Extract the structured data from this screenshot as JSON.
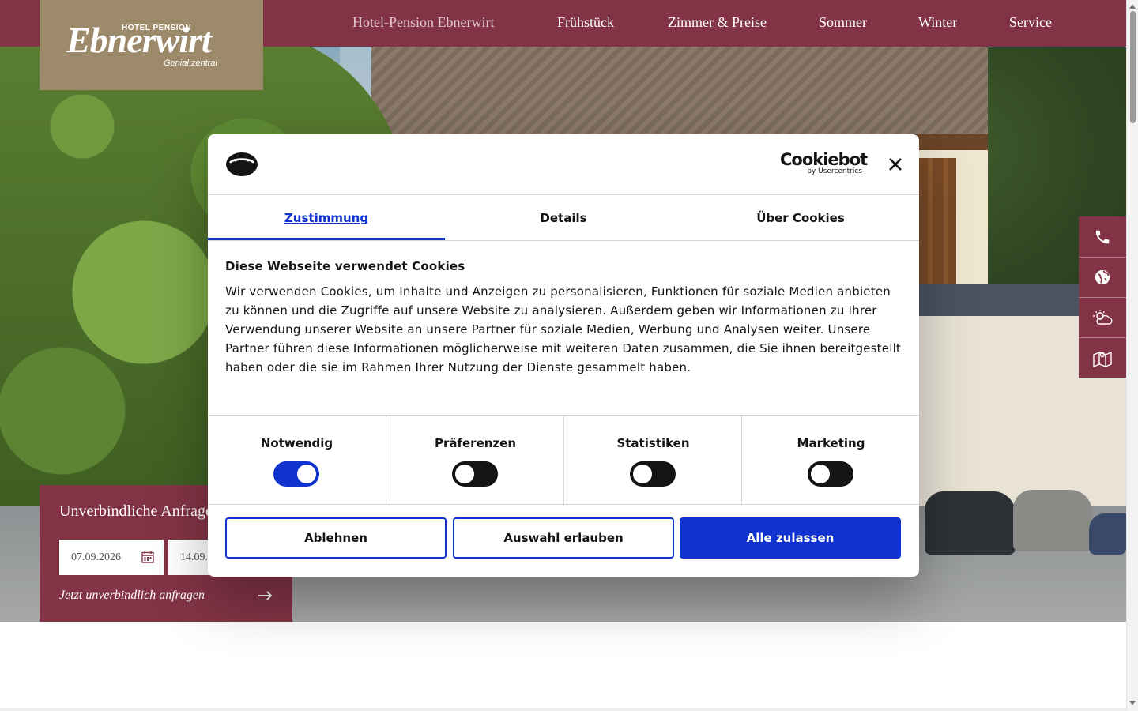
{
  "header": {
    "logo": {
      "small_text": "HOTEL PENSION",
      "name": "Ebnerwirt",
      "tagline": "Genial zentral"
    },
    "nav": [
      {
        "label": "Hotel-Pension Ebnerwirt",
        "active": true
      },
      {
        "label": "Frühstück"
      },
      {
        "label": "Zimmer & Preise"
      },
      {
        "label": "Sommer"
      },
      {
        "label": "Winter"
      },
      {
        "label": "Service"
      }
    ]
  },
  "side_icons": [
    "phone-icon",
    "globe-icon",
    "weather-icon",
    "map-icon"
  ],
  "booking": {
    "title": "Unverbindliche Anfrage",
    "arrival": "07.09.2026",
    "departure": "14.09.2026",
    "cta": "Jetzt unverbindlich anfragen"
  },
  "cookie_dialog": {
    "provider_logo": "Cookiebot",
    "provider_sub": "by Usercentrics",
    "tabs": [
      {
        "label": "Zustimmung",
        "active": true
      },
      {
        "label": "Details"
      },
      {
        "label": "Über Cookies"
      }
    ],
    "heading": "Diese Webseite verwendet Cookies",
    "text": "Wir verwenden Cookies, um Inhalte und Anzeigen zu personalisieren, Funktionen für soziale Medien anbieten zu können und die Zugriffe auf unsere Website zu analysieren. Außerdem geben wir Informationen zu Ihrer Verwendung unserer Website an unsere Partner für soziale Medien, Werbung und Analysen weiter. Unsere Partner führen diese Informationen möglicherweise mit weiteren Daten zusammen, die Sie ihnen bereitgestellt haben oder die sie im Rahmen Ihrer Nutzung der Dienste gesammelt haben.",
    "categories": [
      {
        "label": "Notwendig",
        "enabled": true
      },
      {
        "label": "Präferenzen",
        "enabled": false
      },
      {
        "label": "Statistiken",
        "enabled": false
      },
      {
        "label": "Marketing",
        "enabled": false
      }
    ],
    "buttons": {
      "decline": "Ablehnen",
      "allow_selection": "Auswahl erlauben",
      "allow_all": "Alle zulassen"
    }
  },
  "colors": {
    "brand": "#823446",
    "logo_bg": "#9d8a6b",
    "accent": "#1032cf"
  }
}
